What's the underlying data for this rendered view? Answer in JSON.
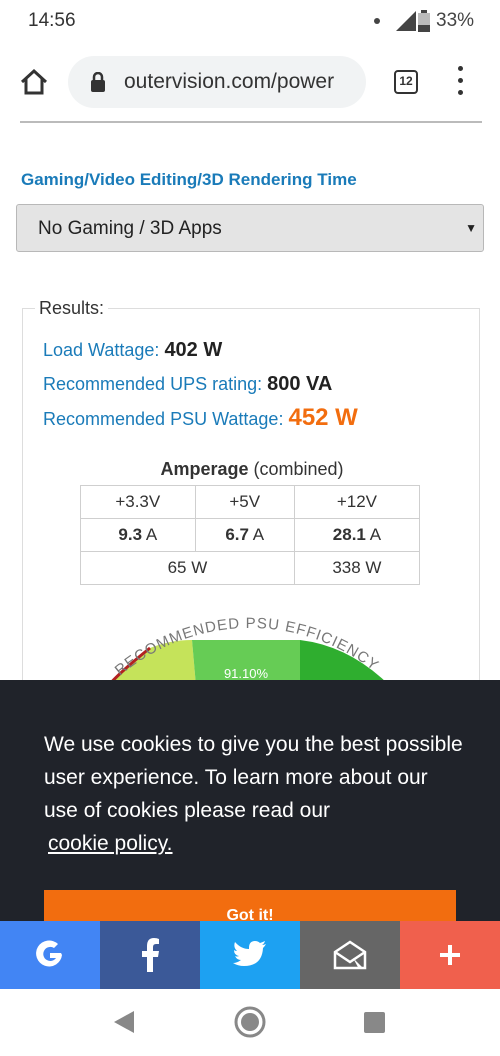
{
  "status_bar": {
    "time": "14:56",
    "battery": "33%"
  },
  "browser": {
    "url": "outervision.com/power",
    "tab_count": "12"
  },
  "form": {
    "label": "Gaming/Video Editing/3D Rendering Time",
    "selected": "No Gaming / 3D Apps"
  },
  "results": {
    "legend": "Results:",
    "load_wattage_label": "Load Wattage:",
    "load_wattage_value": "402 W",
    "ups_label": "Recommended UPS rating:",
    "ups_value": "800 VA",
    "psu_label": "Recommended PSU Wattage:",
    "psu_value": "452 W",
    "amperage_title": "Amperage",
    "amperage_note": "(combined)",
    "rails": [
      "+3.3V",
      "+5V",
      "+12V"
    ],
    "amps": [
      {
        "value": "9.3",
        "unit": "A"
      },
      {
        "value": "6.7",
        "unit": "A"
      },
      {
        "value": "28.1",
        "unit": "A"
      }
    ],
    "watts_combined": "65 W",
    "watts_12v": "338 W",
    "gauge_title": "RECOMMENDED PSU EFFICIENCY",
    "gauge_value": "91.10%"
  },
  "cookie": {
    "text": "We use cookies to give you the best possible user experience. To learn more about our use of cookies please read our",
    "link": "cookie policy.",
    "button": "Got it!"
  },
  "share": {
    "buttons": [
      {
        "icon": "google-icon",
        "color": "#4285f4"
      },
      {
        "icon": "facebook-icon",
        "color": "#3b5998"
      },
      {
        "icon": "twitter-icon",
        "color": "#1da1f2"
      },
      {
        "icon": "email-icon",
        "color": "#666666"
      },
      {
        "icon": "plus-icon",
        "color": "#f0604d"
      }
    ]
  }
}
